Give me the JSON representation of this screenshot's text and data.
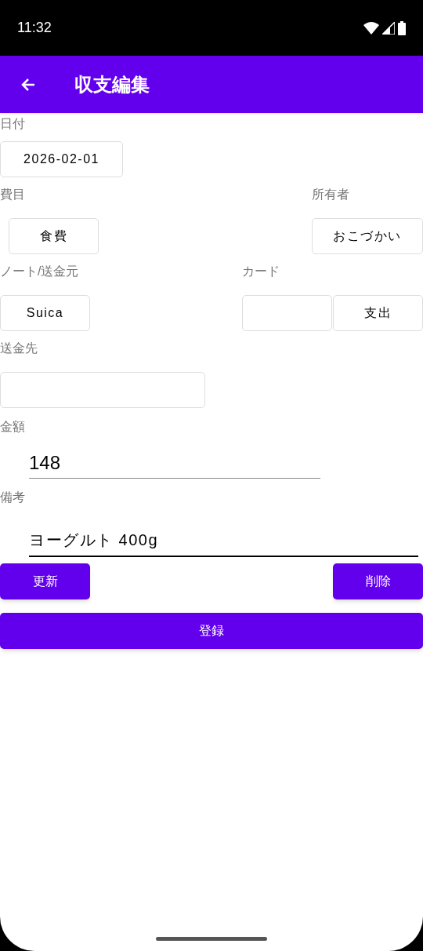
{
  "status_bar": {
    "time": "11:32"
  },
  "app_bar": {
    "title": "収支編集"
  },
  "date": {
    "label": "日付",
    "value": "2026-02-01"
  },
  "category": {
    "label": "費目",
    "value": "食費"
  },
  "owner": {
    "label": "所有者",
    "value": "おこづかい"
  },
  "source": {
    "label": "ノート/送金元",
    "value": "Suica"
  },
  "card": {
    "label": "カード"
  },
  "direction": {
    "value": "支出"
  },
  "destination": {
    "label": "送金先"
  },
  "amount": {
    "label": "金額",
    "value": "148"
  },
  "memo": {
    "label": "備考",
    "value": "ヨーグルト 400g"
  },
  "buttons": {
    "update": "更新",
    "delete": "削除",
    "register": "登録"
  }
}
